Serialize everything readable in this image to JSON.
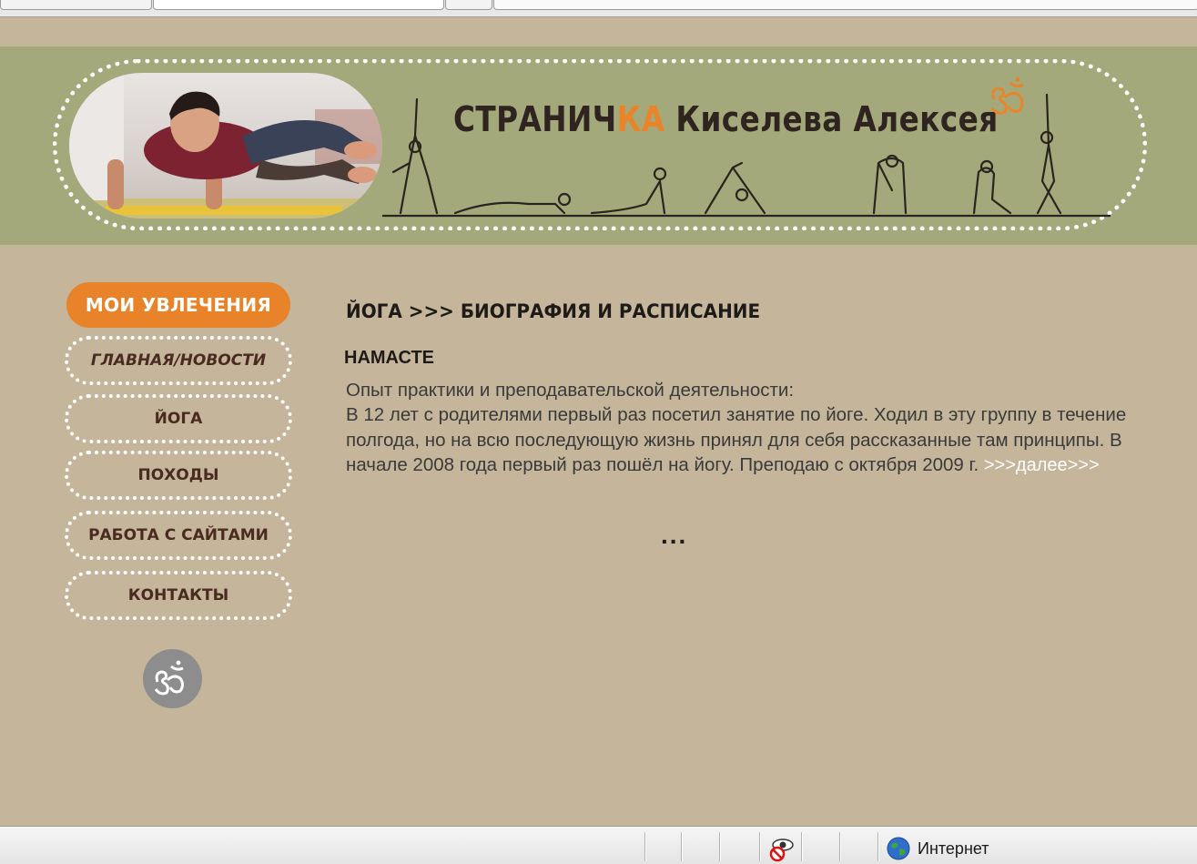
{
  "header": {
    "title_main": "СТРАНИЧ",
    "title_accent": "КА",
    "title_rest": " Киселева Алексея"
  },
  "sidebar": {
    "active_label": "МОИ УВЛЕЧЕНИЯ",
    "items": [
      {
        "label": "ГЛАВНАЯ/НОВОСТИ"
      },
      {
        "label": "ЙОГА"
      },
      {
        "label": "ПОХОДЫ"
      },
      {
        "label": "РАБОТА С САЙТАМИ"
      },
      {
        "label": "КОНТАКТЫ"
      }
    ]
  },
  "main": {
    "title": "ЙОГА >>> БИОГРАФИЯ И РАСПИСАНИЕ",
    "subtitle": "НАМАСТЕ",
    "paragraph_1": "Опыт практики и преподавательской деятельности:",
    "paragraph_2": "В 12 лет с родителями первый раз посетил занятие по йоге. Ходил в эту группу в течение полгода, но на всю последующую жизнь принял для себя рассказанные там принципы. В начале 2008 года первый раз пошёл на йогу. Преподаю с октября 2009 г.",
    "more_link": ">>>далее>>>",
    "ellipsis": "..."
  },
  "statusbar": {
    "zone_text": "Интернет",
    "icons": [
      "privacy-report-icon",
      "internet-zone-globe-icon"
    ]
  },
  "colors": {
    "page_bg": "#c5b59a",
    "header_bg": "#a4a97b",
    "accent": "#e8832a",
    "nav_text": "#4a2b22"
  }
}
